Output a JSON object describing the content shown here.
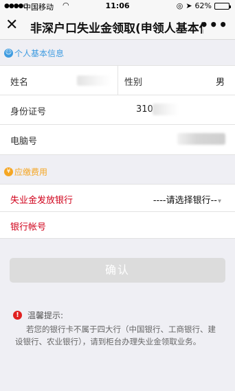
{
  "status_bar": {
    "carrier": "中国移动",
    "time": "11:06",
    "battery": "62%",
    "battery_level": 0.62
  },
  "navbar": {
    "title": "非深户口失业金领取(申领人基本信",
    "close_icon": "close-icon",
    "more_icon": "more-icon"
  },
  "personal_section": {
    "heading": "个人基本信息",
    "icon": "person-icon",
    "name_label": "姓名",
    "gender_label": "性别",
    "gender_value": "男",
    "id_label": "身份证号",
    "id_value": "310",
    "pc_label": "电脑号"
  },
  "fee_section": {
    "heading": "应缴费用",
    "icon": "coin-icon",
    "bank_label": "失业金发放银行",
    "bank_select": "----请选择银行--",
    "account_label": "银行帐号"
  },
  "confirm_label": "确认",
  "tip": {
    "title": "温馨提示:",
    "body": "若您的银行卡不属于四大行（中国银行、工商银行、建设银行、农业银行），请到柜台办理失业金领取业务。"
  },
  "colors": {
    "accent_blue": "#3d9be0",
    "accent_orange": "#f5a623",
    "required_red": "#d0021b",
    "button_disabled": "#dcdcdc"
  }
}
